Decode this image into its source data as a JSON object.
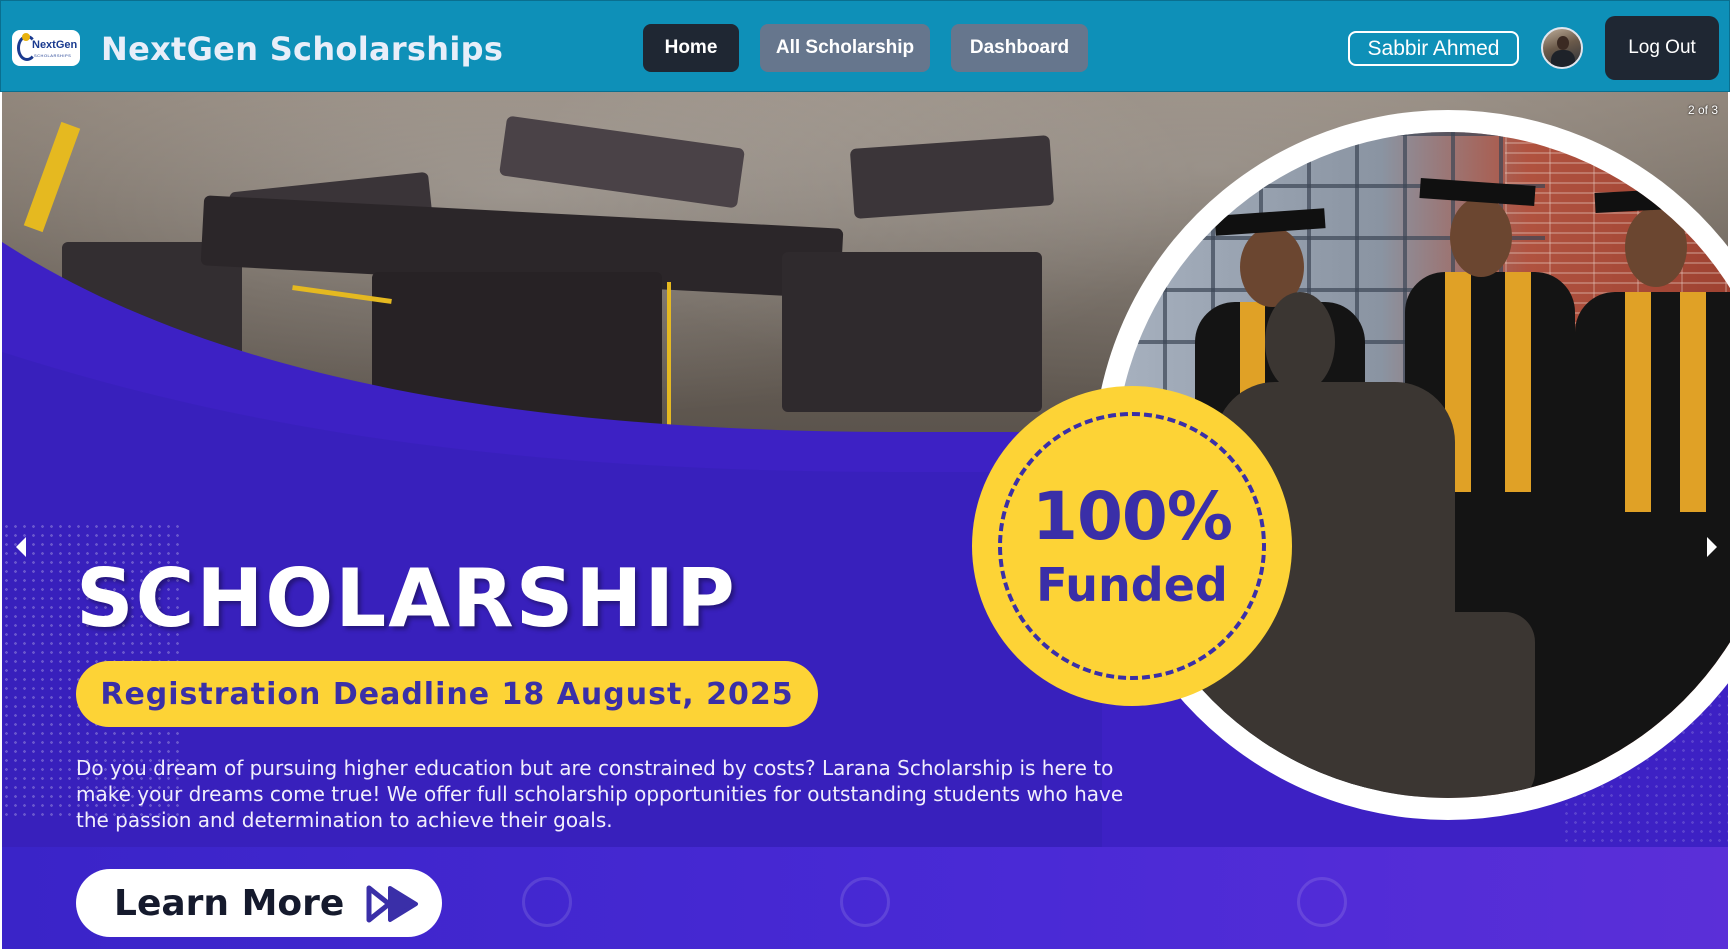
{
  "navbar": {
    "logo_text": "NextGen",
    "logo_sub": "SCHOLARSHIPS",
    "brand": "NextGen Scholarships",
    "links": [
      {
        "label": "Home"
      },
      {
        "label": "All Scholarship"
      },
      {
        "label": "Dashboard"
      }
    ],
    "user_name": "Sabbir Ahmed",
    "logout_label": "Log Out"
  },
  "carousel": {
    "counter": "2 of 3",
    "slide": {
      "headline": "SCHOLARSHIP",
      "deadline": "Registration Deadline 18 August, 2025",
      "badge_percent": "100%",
      "badge_label": "Funded",
      "description": "Do you dream of pursuing higher education but are constrained by costs? Larana Scholarship is here to make your dreams come true! We offer full scholarship opportunities for outstanding students who have the passion and determination to achieve their goals.",
      "cta_label": "Learn More"
    }
  },
  "colors": {
    "navbar_bg": "#0e90b8",
    "active_nav": "#1f2733",
    "inactive_nav": "#66768d",
    "hero_blue": "#3d21c4",
    "badge_yellow": "#fdd336",
    "badge_text": "#3a2fa8"
  },
  "icons": [
    "logo-icon",
    "avatar",
    "chevron-left-icon",
    "chevron-right-icon",
    "double-arrow-right-icon",
    "phone-icon",
    "globe-icon"
  ]
}
